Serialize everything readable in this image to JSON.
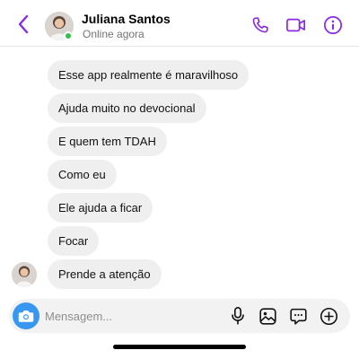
{
  "colors": {
    "accent": "#8a2be2",
    "bubble": "#efefef",
    "online": "#31c24a",
    "camera": "#3897f0"
  },
  "header": {
    "name": "Juliana Santos",
    "status": "Online agora",
    "icons": [
      "chevron-left-icon",
      "phone-icon",
      "video-icon",
      "info-icon"
    ]
  },
  "messages": [
    {
      "text": "Esse app realmente é maravilhoso"
    },
    {
      "text": "Ajuda muito no devocional"
    },
    {
      "text": "E quem tem TDAH"
    },
    {
      "text": "Como eu"
    },
    {
      "text": "Ele ajuda a ficar"
    },
    {
      "text": "Focar"
    },
    {
      "text": "Prende a atenção"
    }
  ],
  "composer": {
    "placeholder": "Mensagem...",
    "icons": [
      "camera-icon",
      "microphone-icon",
      "image-icon",
      "sticker-icon",
      "plus-icon"
    ]
  }
}
